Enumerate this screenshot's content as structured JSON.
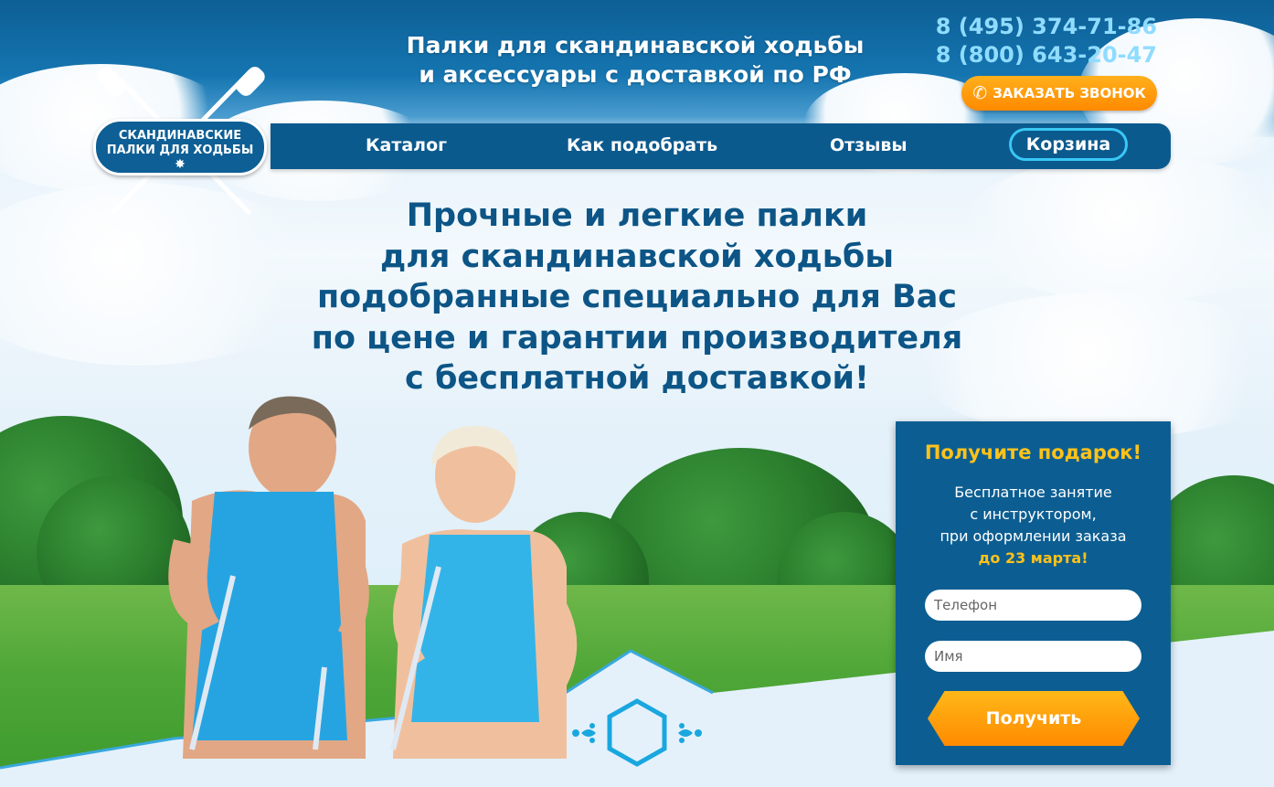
{
  "header": {
    "tagline_line1": "Палки для скандинавской ходьбы",
    "tagline_line2": "и аксессуары с доставкой по РФ",
    "phone1": "8 (495) 374-71-86",
    "phone2": "8 (800) 643-20-47",
    "callback_label": "ЗАКАЗАТЬ ЗВОНОК",
    "callback_icon": "phone-handset-icon"
  },
  "logo": {
    "line1": "СКАНДИНАВСКИЕ",
    "line2": "ПАЛКИ ДЛЯ ХОДЬБЫ"
  },
  "nav": {
    "items": [
      {
        "label": "Каталог"
      },
      {
        "label": "Как подобрать"
      },
      {
        "label": "Отзывы"
      }
    ],
    "cart_label": "Корзина"
  },
  "hero": {
    "lines": [
      "Прочные и легкие палки",
      "для скандинавской ходьбы",
      "подобранные специально для Вас",
      "по цене и гарантии производителя",
      "с бесплатной доставкой!"
    ]
  },
  "gift_form": {
    "title": "Получите подарок!",
    "text_line1": "Бесплатное занятие",
    "text_line2": "с инструктором,",
    "text_line3": "при оформлении заказа",
    "deadline": "до 23 марта!",
    "phone_placeholder": "Телефон",
    "name_placeholder": "Имя",
    "submit_label": "Получить"
  },
  "colors": {
    "brand_blue": "#0c5e92",
    "headline_blue": "#0c5586",
    "accent_orange": "#ff8a00",
    "accent_yellow": "#ffc21a",
    "cart_border": "#39c8f5"
  }
}
